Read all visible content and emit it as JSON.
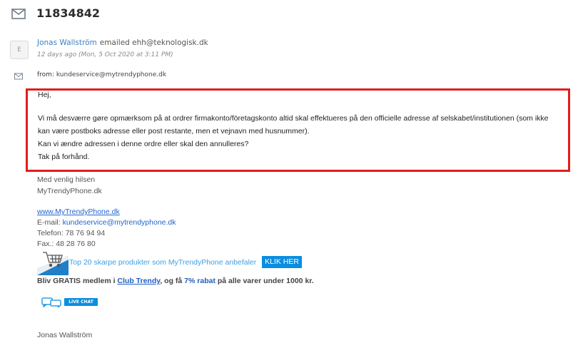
{
  "ticket": {
    "number": "11834842"
  },
  "message": {
    "avatar_letter": "E",
    "author": "Jonas Wallström",
    "action": "emailed ehh@teknologisk.dk",
    "time": "12 days ago (Mon, 5 Oct 2020 at 3:11 PM)",
    "from_label": "from:",
    "from_address": "kundeservice@mytrendyphone.dk"
  },
  "body": {
    "greeting": "Hej,",
    "line1": "Vi må desværre gøre opmærksom på at ordrer firmakonto/företagskonto altid skal effektueres på den officielle adresse af selskabet/institutionen (som ikke",
    "line2": "kan være postboks adresse eller post restante, men et vejnavn med husnummer).",
    "line3": "Kan vi ændre adressen i denne ordre eller skal den annulleres?",
    "line4": "Tak på forhånd."
  },
  "signature": {
    "closing": "Med venlig hilsen",
    "company": "MyTrendyPhone.dk",
    "website": "www.MyTrendyPhone.dk",
    "email_label": "E-mail: ",
    "email": "kundeservice@mytrendyphone.dk",
    "phone": "Telefon: 78 76 94 94",
    "fax": "Fax.: 48 28 76 80",
    "banner_text": "Top 20 skarpe produkter som MyTrendyPhone anbefaler",
    "banner_button": "KLIK HER",
    "club_pre": "Bliv GRATIS medlem i ",
    "club_link": "Club Trendy",
    "club_mid": ", og få ",
    "club_discount": "7% rabat",
    "club_post": " på alle varer under 1000 kr.",
    "live_chat": "LIVE CHAT"
  },
  "footer_name": "Jonas Wallström",
  "colors": {
    "highlight_border": "#e11d1d",
    "link": "#2266cc",
    "accent": "#0b8ee0"
  }
}
